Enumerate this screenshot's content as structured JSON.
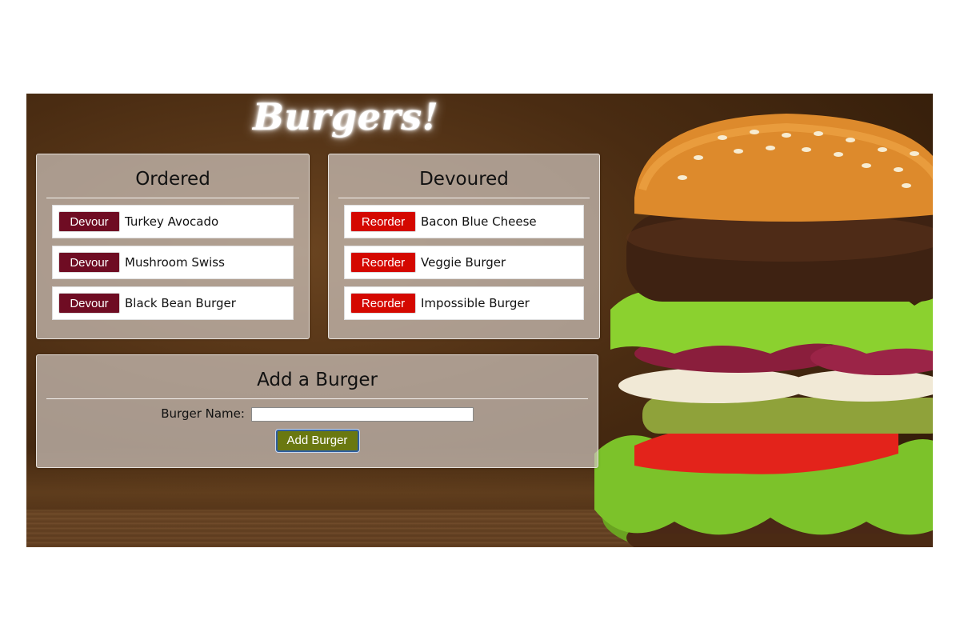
{
  "header": {
    "title": "Burgers!"
  },
  "ordered": {
    "heading": "Ordered",
    "button_label": "Devour",
    "items": [
      "Turkey Avocado",
      "Mushroom Swiss",
      "Black Bean Burger"
    ]
  },
  "devoured": {
    "heading": "Devoured",
    "button_label": "Reorder",
    "items": [
      "Bacon Blue Cheese",
      "Veggie Burger",
      "Impossible Burger"
    ]
  },
  "add_form": {
    "heading": "Add a Burger",
    "field_label": "Burger Name:",
    "field_value": "",
    "submit_label": "Add Burger"
  },
  "colors": {
    "devour_button": "#6f0c23",
    "reorder_button": "#d40800",
    "add_button": "#6a7810"
  }
}
